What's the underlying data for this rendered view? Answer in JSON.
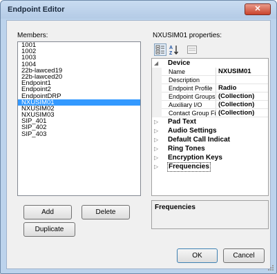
{
  "window": {
    "title": "Endpoint Editor",
    "close_glyph": "✕"
  },
  "members": {
    "label": "Members:",
    "items": [
      "1001",
      "1002",
      "1003",
      "1004",
      "22b-lawced19",
      "22b-lawced20",
      "Endpoint1",
      "Endpoint2",
      "EndpointDRP",
      "NXUSIM01",
      "NXUSIM02",
      "NXUSIM03",
      "SIP_401",
      "SIP_402",
      "SIP_403"
    ],
    "selected": "NXUSIM01"
  },
  "buttons": {
    "add": "Add",
    "delete": "Delete",
    "duplicate": "Duplicate",
    "ok": "OK",
    "cancel": "Cancel"
  },
  "properties": {
    "label": "NXUSIM01 properties:",
    "toolbar_icons": [
      "categorized-icon",
      "alphabetical-icon",
      "property-pages-icon"
    ],
    "device": {
      "category": "Device",
      "rows": [
        {
          "name": "Name",
          "value": "NXUSIM01"
        },
        {
          "name": "Description",
          "value": ""
        },
        {
          "name": "Endpoint Profile",
          "value": "Radio"
        },
        {
          "name": "Endpoint Groups",
          "value": "(Collection)"
        },
        {
          "name": "Auxiliary I/O",
          "value": "(Collection)"
        },
        {
          "name": "Contact Group Filt",
          "value": "(Collection)"
        }
      ]
    },
    "collapsed_categories": [
      "Pad Text",
      "Audio Settings",
      "Default Call Indicat",
      "Ring Tones",
      "Encryption Keys",
      "Frequencies"
    ]
  },
  "description_panel": {
    "title": "Frequencies"
  },
  "colors": {
    "selection": "#3399ff",
    "window_frame": "#bcd3ec",
    "close_button": "#c9442c"
  }
}
